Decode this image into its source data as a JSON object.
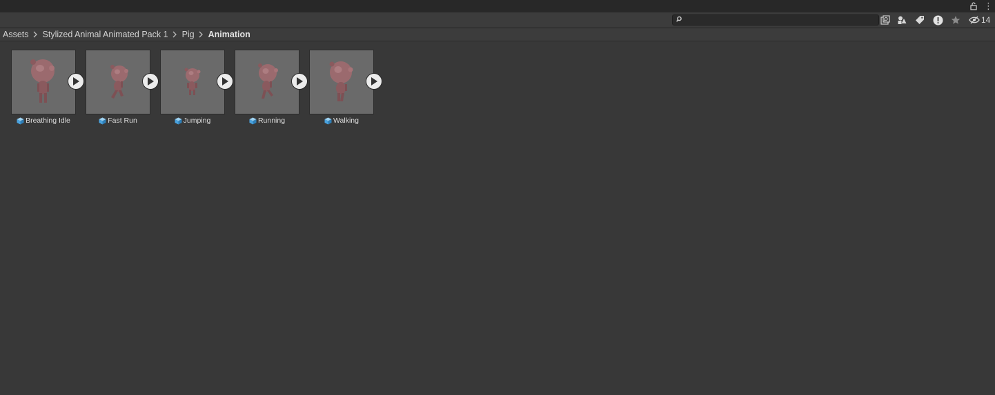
{
  "toolbar": {
    "search_value": "",
    "hidden_count": "14"
  },
  "breadcrumb": [
    "Assets",
    "Stylized Animal Animated Pack 1",
    "Pig",
    "Animation"
  ],
  "assets": [
    {
      "name": "Breathing Idle"
    },
    {
      "name": "Fast Run"
    },
    {
      "name": "Jumping"
    },
    {
      "name": "Running"
    },
    {
      "name": "Walking"
    }
  ],
  "colors": {
    "background": "#383838",
    "thumbnail": "#6a6a6a",
    "pig": "#9b6a6e",
    "model_icon": "#4aa3df"
  },
  "icons": {
    "lock": "lock-icon",
    "menu": "kebab-menu-icon",
    "search": "search-icon",
    "by_type": "search-by-type-icon",
    "by_label": "search-by-label-icon",
    "issues": "issues-icon",
    "favorites": "star-icon",
    "hidden": "eye-slash-icon",
    "model": "model-cube-icon",
    "play": "play-icon"
  }
}
